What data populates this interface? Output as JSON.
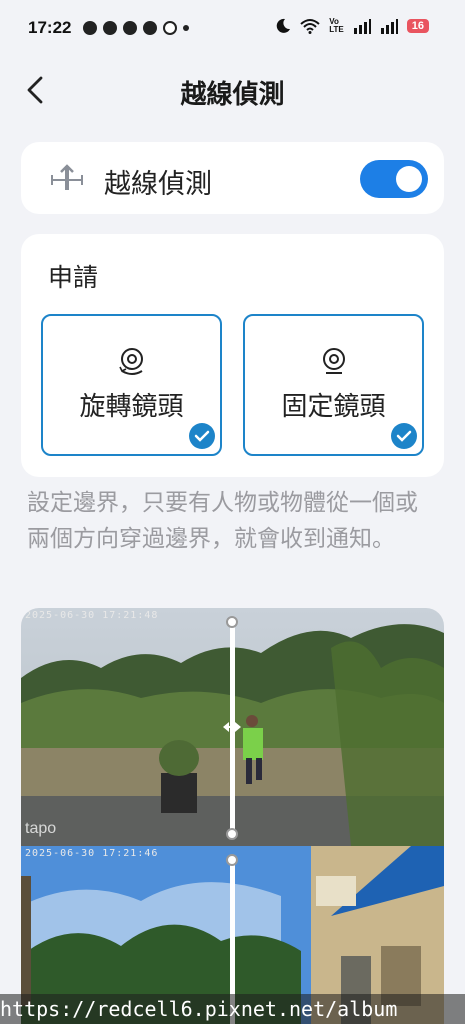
{
  "status_bar": {
    "time": "17:22",
    "lte_top": "Vo",
    "lte_bottom": "LTE",
    "battery": "16"
  },
  "header": {
    "title": "越線偵測"
  },
  "toggle_card": {
    "label": "越線偵測",
    "enabled": true
  },
  "apply_card": {
    "title": "申請",
    "options": [
      {
        "label": "旋轉鏡頭",
        "selected": true
      },
      {
        "label": "固定鏡頭",
        "selected": true
      }
    ]
  },
  "description": "設定邊界，只要有人物或物體從一個或兩個方向穿過邊界，就會收到通知。",
  "preview": {
    "cam1_timestamp": "2025-06-30 17:21:48",
    "cam1_logo": "tapo",
    "cam2_timestamp": "2025-06-30 17:21:46"
  },
  "watermark": "https://redcell6.pixnet.net/album",
  "colors": {
    "accent": "#1d7fe6",
    "selection_border": "#1d84c9",
    "background": "#f2f3f7",
    "battery": "#e9545f"
  }
}
